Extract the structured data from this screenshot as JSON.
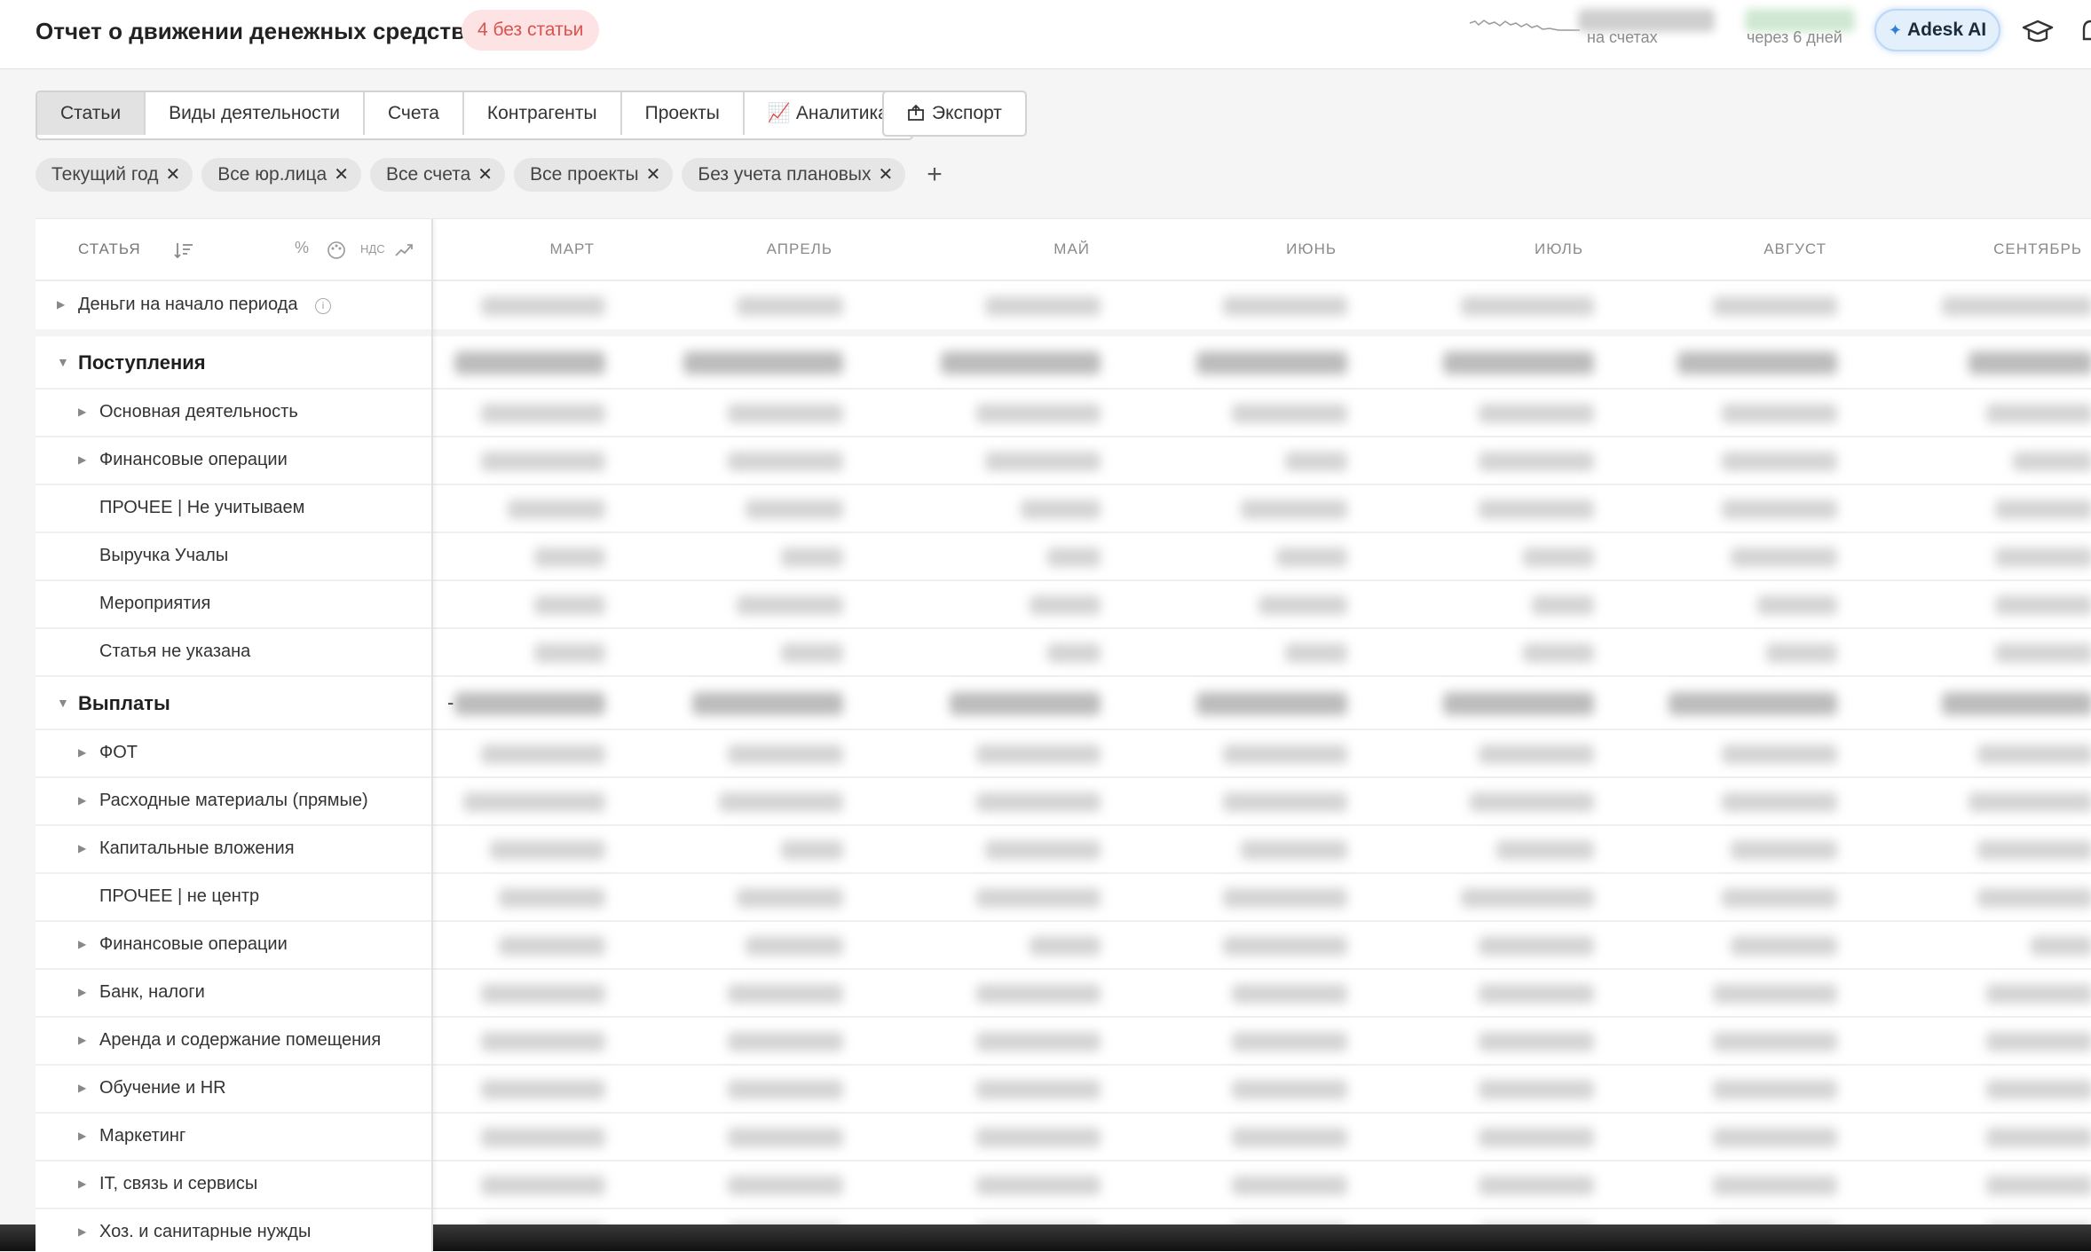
{
  "header": {
    "title": "Отчет о движении денежных средств",
    "badge": "4 без статьи",
    "balance_caption": "на счетах",
    "forecast_caption": "через 6 дней",
    "ai_button_label": "Adesk AI"
  },
  "tabs": [
    {
      "label": "Статьи",
      "active": true
    },
    {
      "label": "Виды деятельности",
      "active": false
    },
    {
      "label": "Счета",
      "active": false
    },
    {
      "label": "Контрагенты",
      "active": false
    },
    {
      "label": "Проекты",
      "active": false
    },
    {
      "label": "📈 Аналитика",
      "active": false
    }
  ],
  "export_label": "Экспорт",
  "filters": [
    "Текущий год",
    "Все юр.лица",
    "Все счета",
    "Все проекты",
    "Без учета плановых"
  ],
  "table": {
    "column_header": "СТАТЬЯ",
    "vat_label": "НДС",
    "months": [
      "МАРТ",
      "АПРЕЛЬ",
      "МАЙ",
      "ИЮНЬ",
      "ИЮЛЬ",
      "АВГУСТ",
      "СЕНТЯБРЬ"
    ],
    "rows": [
      {
        "label": "Деньги на начало периода",
        "type": "opening",
        "expandable": true
      },
      {
        "label": "Поступления",
        "type": "group",
        "expandable": true
      },
      {
        "label": "Основная деятельность",
        "type": "item",
        "expandable": true
      },
      {
        "label": "Финансовые операции",
        "type": "item",
        "expandable": true
      },
      {
        "label": "ПРОЧЕЕ | Не учитываем",
        "type": "item",
        "expandable": false
      },
      {
        "label": "Выручка Учалы",
        "type": "item",
        "expandable": false
      },
      {
        "label": "Мероприятия",
        "type": "item",
        "expandable": false
      },
      {
        "label": "Статья не указана",
        "type": "item",
        "expandable": false
      },
      {
        "label": "Выплаты",
        "type": "group",
        "expandable": true
      },
      {
        "label": "ФОТ",
        "type": "item",
        "expandable": true
      },
      {
        "label": "Расходные материалы (прямые)",
        "type": "item",
        "expandable": true
      },
      {
        "label": "Капитальные вложения",
        "type": "item",
        "expandable": true
      },
      {
        "label": "ПРОЧЕЕ | не центр",
        "type": "item",
        "expandable": false
      },
      {
        "label": "Финансовые операции",
        "type": "item",
        "expandable": true
      },
      {
        "label": "Банк, налоги",
        "type": "item",
        "expandable": true
      },
      {
        "label": "Аренда и содержание помещения",
        "type": "item",
        "expandable": true
      },
      {
        "label": "Обучение и HR",
        "type": "item",
        "expandable": true
      },
      {
        "label": "Маркетинг",
        "type": "item",
        "expandable": true
      },
      {
        "label": "IT, связь и сервисы",
        "type": "item",
        "expandable": true
      },
      {
        "label": "Хоз. и санитарные нужды",
        "type": "item",
        "expandable": true
      }
    ],
    "payments_prefix": "-"
  }
}
